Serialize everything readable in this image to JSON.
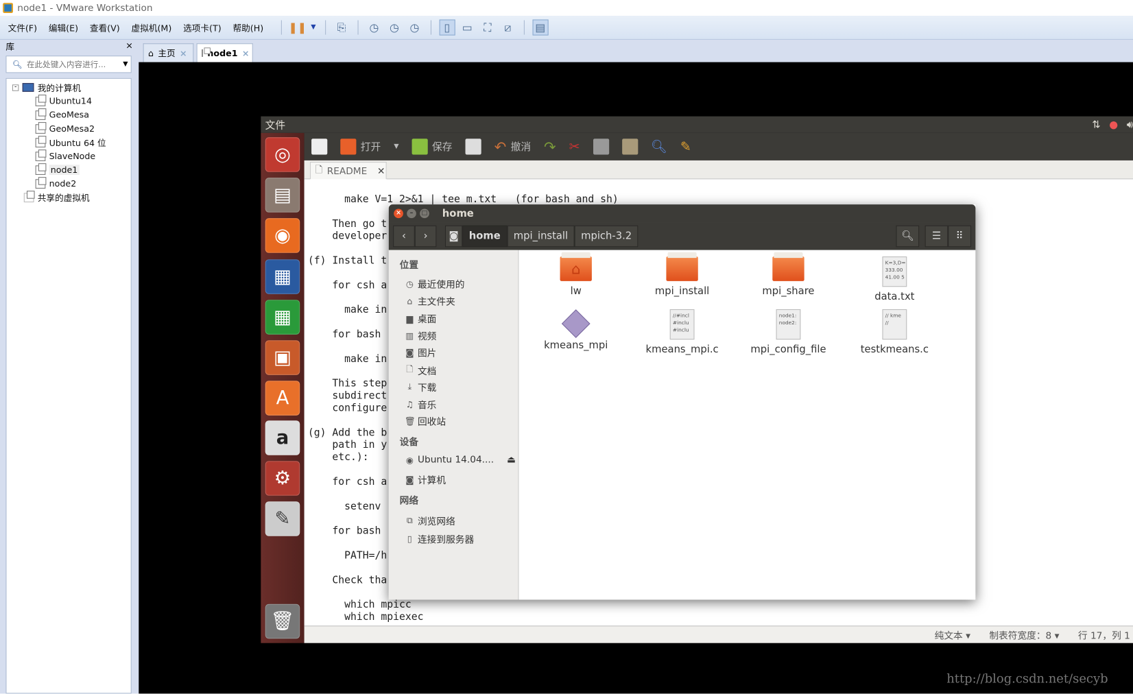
{
  "window": {
    "title": "node1 - VMware Workstation"
  },
  "menu": [
    "文件(F)",
    "编辑(E)",
    "查看(V)",
    "虚拟机(M)",
    "选项卡(T)",
    "帮助(H)"
  ],
  "library": {
    "title": "库",
    "close": "×",
    "search_placeholder": "在此处键入内容进行...",
    "tree": {
      "root": "我的计算机",
      "items": [
        "Ubuntu14",
        "GeoMesa",
        "GeoMesa2",
        "Ubuntu 64 位",
        "SlaveNode",
        "node1",
        "node2"
      ],
      "shared": "共享的虚拟机",
      "selected": "node1"
    }
  },
  "tabs": [
    {
      "label": "主页"
    },
    {
      "label": "node1"
    }
  ],
  "ubuntu": {
    "panel_title": "文件"
  },
  "gedit": {
    "open": "打开",
    "save": "保存",
    "undo": "撤消",
    "doc_tab": "README",
    "lines": [
      "      make V=1 2>&1 | tee m.txt   (for bash and sh)",
      "",
      "    Then go t",
      "    developer",
      "",
      "(f) Install t",
      "",
      "    for csh a",
      "",
      "      make in",
      "",
      "    for bash",
      "",
      "      make in",
      "",
      "    This step",
      "    subdirect",
      "    configure",
      "",
      "(g) Add the b",
      "    path in y",
      "    etc.):",
      "",
      "    for csh a",
      "",
      "      setenv",
      "",
      "    for bash",
      "",
      "      PATH=/h",
      "",
      "    Check tha",
      "",
      "      which mpicc",
      "      which mpiexec"
    ],
    "status": {
      "lang": "纯文本 ▾",
      "tab_width": "制表符宽度：8 ▾",
      "position": "行 17，列 1"
    }
  },
  "nautilus": {
    "title": "home",
    "path": [
      "home",
      "mpi_install",
      "mpich-3.2"
    ],
    "sidebar": {
      "places_header": "位置",
      "places": [
        "最近使用的",
        "主文件夹",
        "桌面",
        "视频",
        "图片",
        "文档",
        "下载",
        "音乐",
        "回收站"
      ],
      "devices_header": "设备",
      "devices": [
        "Ubuntu 14.04....",
        "计算机"
      ],
      "network_header": "网络",
      "network": [
        "浏览网络",
        "连接到服务器"
      ]
    },
    "files": [
      {
        "name": "lw",
        "type": "home-folder"
      },
      {
        "name": "mpi_install",
        "type": "folder"
      },
      {
        "name": "mpi_share",
        "type": "folder"
      },
      {
        "name": "data.txt",
        "type": "text",
        "preview": "K=3,D=\n333.00\n41.00 5"
      },
      {
        "name": "kmeans_mpi",
        "type": "executable"
      },
      {
        "name": "kmeans_mpi.c",
        "type": "text",
        "preview": "//#incl\n#inclu\n#inclu"
      },
      {
        "name": "mpi_config_file",
        "type": "text",
        "preview": "node1:\nnode2:"
      },
      {
        "name": "testkmeans.c",
        "type": "text",
        "preview": "// kme\n//"
      }
    ]
  },
  "watermark": "http://blog.csdn.net/secyb"
}
